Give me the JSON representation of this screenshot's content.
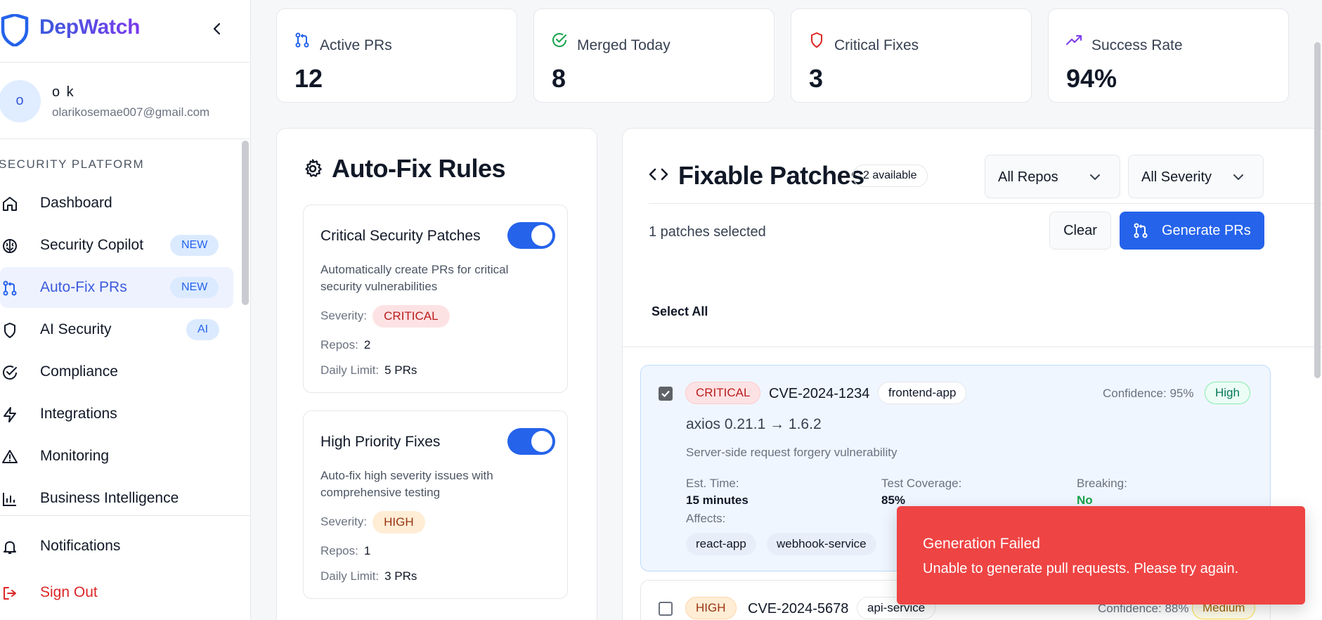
{
  "brand": {
    "name": "DepWatch"
  },
  "user": {
    "initial": "o",
    "name": "o k",
    "email": "olarikosemae007@gmail.com"
  },
  "sidebar": {
    "section_label": "SECURITY PLATFORM",
    "items": [
      {
        "label": "Dashboard",
        "icon": "home-icon"
      },
      {
        "label": "Security Copilot",
        "icon": "brain-icon",
        "badge": "NEW"
      },
      {
        "label": "Auto-Fix PRs",
        "icon": "git-pull-request-icon",
        "badge": "NEW",
        "active": true
      },
      {
        "label": "AI Security",
        "icon": "shield-icon",
        "badge": "AI"
      },
      {
        "label": "Compliance",
        "icon": "check-circle-icon"
      },
      {
        "label": "Integrations",
        "icon": "zap-icon"
      },
      {
        "label": "Monitoring",
        "icon": "alert-triangle-icon"
      },
      {
        "label": "Business Intelligence",
        "icon": "bar-chart-icon"
      }
    ],
    "notifications": "Notifications",
    "sign_out": "Sign Out"
  },
  "stats": [
    {
      "label": "Active PRs",
      "value": "12",
      "icon": "git-pull-request-icon",
      "color": "#2563eb"
    },
    {
      "label": "Merged Today",
      "value": "8",
      "icon": "check-circle-icon",
      "color": "#16a34a"
    },
    {
      "label": "Critical Fixes",
      "value": "3",
      "icon": "shield-icon",
      "color": "#dc2626"
    },
    {
      "label": "Success Rate",
      "value": "94%",
      "icon": "trending-up-icon",
      "color": "#7c3aed"
    }
  ],
  "rules": {
    "title": "Auto-Fix Rules",
    "items": [
      {
        "name": "Critical Security Patches",
        "description": "Automatically create PRs for critical security vulnerabilities",
        "severity_label": "Severity:",
        "severity": "CRITICAL",
        "repos_label": "Repos:",
        "repos": "2",
        "limit_label": "Daily Limit:",
        "limit": "5 PRs",
        "enabled": true
      },
      {
        "name": "High Priority Fixes",
        "description": "Auto-fix high severity issues with comprehensive testing",
        "severity_label": "Severity:",
        "severity": "HIGH",
        "repos_label": "Repos:",
        "repos": "1",
        "limit_label": "Daily Limit:",
        "limit": "3 PRs",
        "enabled": true
      }
    ]
  },
  "patches": {
    "title": "Fixable Patches",
    "available": "2 available",
    "repo_filter": "All Repos",
    "severity_filter": "All Severity",
    "selected_text": "1 patches selected",
    "clear_label": "Clear",
    "generate_label": "Generate PRs",
    "select_all": "Select All",
    "items": [
      {
        "severity": "CRITICAL",
        "cve": "CVE-2024-1234",
        "repo": "frontend-app",
        "confidence": "Confidence: 95%",
        "confidence_level": "High",
        "package": "axios 0.21.1 → 1.6.2",
        "description": "Server-side request forgery vulnerability",
        "est_time_label": "Est. Time:",
        "est_time": "15 minutes",
        "coverage_label": "Test Coverage:",
        "coverage": "85%",
        "breaking_label": "Breaking:",
        "breaking": "No",
        "affects_label": "Affects:",
        "affects": [
          "react-app",
          "webhook-service"
        ],
        "checked": true
      },
      {
        "severity": "HIGH",
        "cve": "CVE-2024-5678",
        "repo": "api-service",
        "confidence": "Confidence: 88%",
        "confidence_level": "Medium",
        "checked": false
      }
    ]
  },
  "toast": {
    "title": "Generation Failed",
    "message": "Unable to generate pull requests. Please try again."
  }
}
